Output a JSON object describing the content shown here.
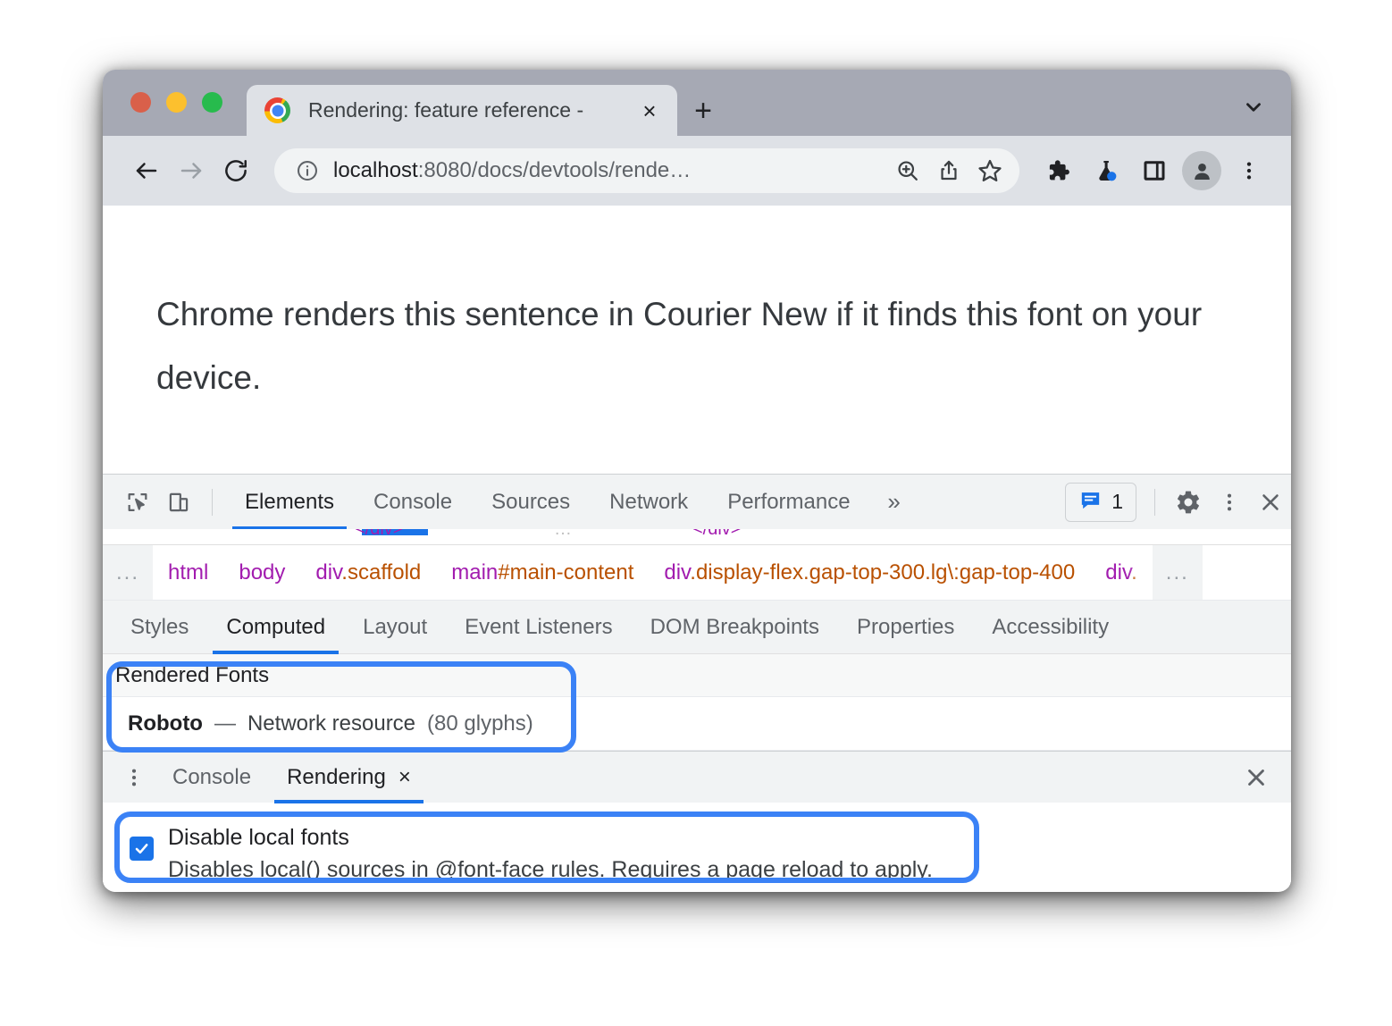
{
  "window": {
    "traffic_lights": [
      "close",
      "minimize",
      "maximize"
    ],
    "tab_search_icon": "chevron-down-icon"
  },
  "browser": {
    "tab": {
      "title": "Rendering: feature reference - ",
      "favicon": "chrome-logo-icon",
      "close_label": "×"
    },
    "new_tab_label": "+",
    "toolbar": {
      "back_icon": "back-arrow-icon",
      "forward_icon": "forward-arrow-icon",
      "reload_icon": "reload-icon",
      "info_icon": "info-circle-icon",
      "url_host": "localhost",
      "url_rest": ":8080/docs/devtools/rende…",
      "zoom_icon": "zoom-in-icon",
      "share_icon": "share-icon",
      "bookmark_icon": "star-icon",
      "extensions_icon": "puzzle-icon",
      "experiments_icon": "flask-icon",
      "side_panel_icon": "side-panel-icon",
      "profile_icon": "person-icon",
      "menu_icon": "three-dot-menu-icon"
    }
  },
  "page": {
    "sentence": "Chrome renders this sentence in Courier New if it finds this font on your device."
  },
  "devtools": {
    "inspect_icon": "inspect-cursor-icon",
    "device_toolbar_icon": "device-toggle-icon",
    "tabs": [
      {
        "label": "Elements",
        "active": true
      },
      {
        "label": "Console",
        "active": false
      },
      {
        "label": "Sources",
        "active": false
      },
      {
        "label": "Network",
        "active": false
      },
      {
        "label": "Performance",
        "active": false
      }
    ],
    "overflow_label": "»",
    "issues": {
      "icon": "issues-message-icon",
      "count": "1"
    },
    "settings_icon": "gear-icon",
    "more_icon": "three-dot-menu-icon",
    "close_icon": "close-icon",
    "breadcrumb": {
      "left_ellipsis": "...",
      "right_ellipsis": "...",
      "items": [
        {
          "tag": "html",
          "cls": ""
        },
        {
          "tag": "body",
          "cls": ""
        },
        {
          "tag": "div",
          "cls": ".scaffold"
        },
        {
          "tag": "main",
          "cls": "#main-content"
        },
        {
          "tag": "div",
          "cls": ".display-flex.gap-top-300.lg\\:gap-top-400"
        },
        {
          "tag": "div",
          "cls": "."
        }
      ]
    },
    "sub_tabs": [
      {
        "label": "Styles",
        "active": false
      },
      {
        "label": "Computed",
        "active": true
      },
      {
        "label": "Layout",
        "active": false
      },
      {
        "label": "Event Listeners",
        "active": false
      },
      {
        "label": "DOM Breakpoints",
        "active": false
      },
      {
        "label": "Properties",
        "active": false
      },
      {
        "label": "Accessibility",
        "active": false
      }
    ],
    "rendered_fonts": {
      "header": "Rendered Fonts",
      "font_name": "Roboto",
      "dash": "—",
      "source": "Network resource",
      "glyphs": "(80 glyphs)"
    },
    "drawer": {
      "menu_icon": "three-dot-menu-icon",
      "tabs": [
        {
          "label": "Console",
          "active": false,
          "closable": false
        },
        {
          "label": "Rendering",
          "active": true,
          "closable": true
        }
      ],
      "tab_close_label": "×",
      "close_icon": "close-icon",
      "setting": {
        "checked": true,
        "label": "Disable local fonts",
        "description": "Disables local() sources in @font-face rules. Requires a page reload to apply."
      }
    }
  },
  "annotations": {
    "highlight_color": "#3b82f6",
    "regions": [
      "rendered-fonts",
      "disable-local-fonts-setting"
    ]
  }
}
